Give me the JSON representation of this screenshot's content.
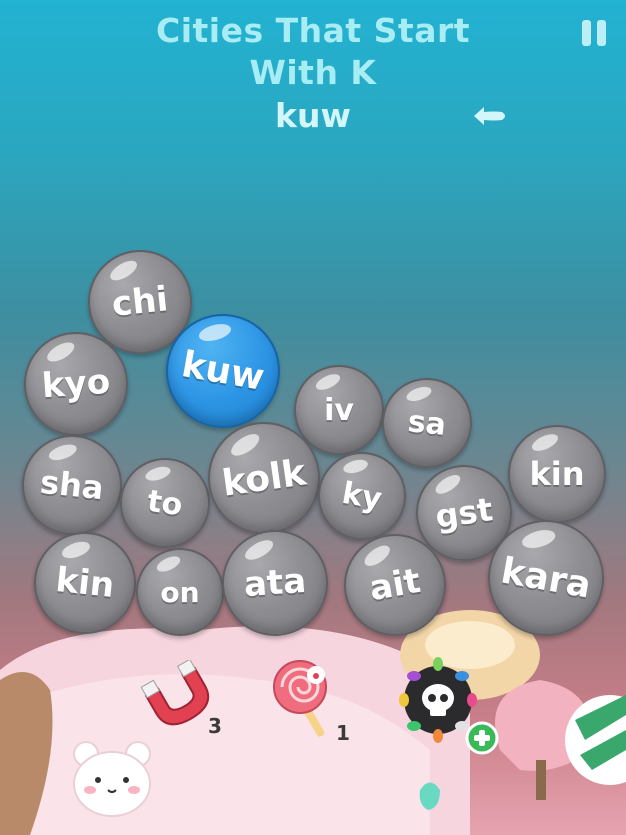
{
  "header": {
    "title_line1": "Cities That Start",
    "title_line2": "With K",
    "current_word": "kuw"
  },
  "bubbles": [
    {
      "text": "chi",
      "selected": false
    },
    {
      "text": "kyo",
      "selected": false
    },
    {
      "text": "kuw",
      "selected": true
    },
    {
      "text": "iv",
      "selected": false
    },
    {
      "text": "sa",
      "selected": false
    },
    {
      "text": "sha",
      "selected": false
    },
    {
      "text": "to",
      "selected": false
    },
    {
      "text": "kolk",
      "selected": false
    },
    {
      "text": "ky",
      "selected": false
    },
    {
      "text": "gst",
      "selected": false
    },
    {
      "text": "kin",
      "selected": false
    },
    {
      "text": "kin",
      "selected": false
    },
    {
      "text": "on",
      "selected": false
    },
    {
      "text": "ata",
      "selected": false
    },
    {
      "text": "ait",
      "selected": false
    },
    {
      "text": "kara",
      "selected": false
    }
  ],
  "powerups": {
    "magnet": {
      "icon": "magnet-icon",
      "count": "3"
    },
    "lollipop": {
      "icon": "lollipop-icon",
      "count": "1"
    },
    "bomb": {
      "icon": "skull-bomb-icon"
    }
  },
  "colors": {
    "selected_bubble": "#2e96e6",
    "bubble": "#8e8e93",
    "title": "#a8ecf4"
  }
}
